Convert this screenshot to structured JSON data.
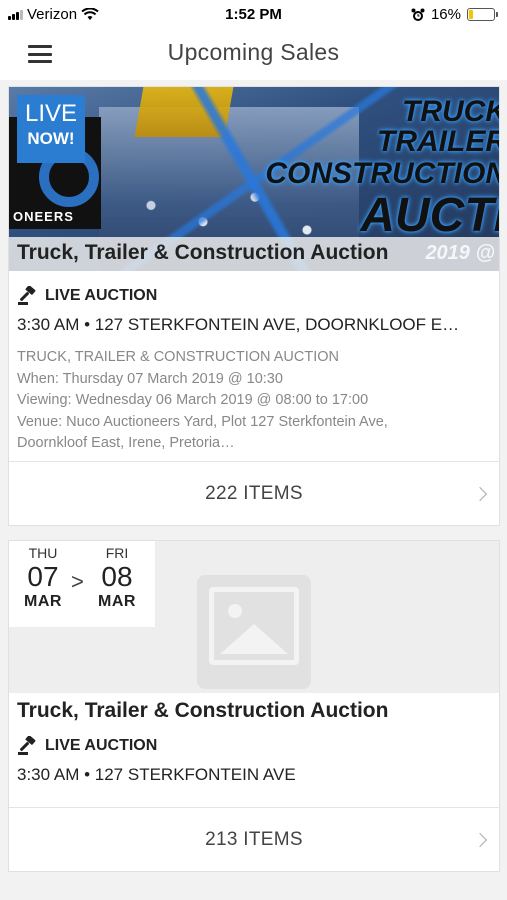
{
  "status_bar": {
    "carrier": "Verizon",
    "time": "1:52 PM",
    "battery_percent": "16%",
    "battery_level": 0.16
  },
  "header": {
    "title": "Upcoming Sales",
    "menu_icon": "hamburger-menu-icon"
  },
  "sales": [
    {
      "banner": {
        "live_badge_line1": "LIVE",
        "live_badge_line2": "NOW!",
        "logo_text": "ONEERS",
        "words": [
          "TRUCK",
          "TRAILER",
          "CONSTRUCTION",
          "AUCTI"
        ],
        "overlay_title": "Truck, Trailer & Construction Auction",
        "overlay_year": "2019 @"
      },
      "type": "LIVE AUCTION",
      "time_location": "3:30 AM • 127 STERKFONTEIN AVE, DOORNKLOOF E…",
      "description": [
        "TRUCK, TRAILER & CONSTRUCTION AUCTION",
        "When: Thursday 07 March 2019 @ 10:30",
        "Viewing: Wednesday 06 March 2019 @ 08:00 to 17:00",
        "Venue: Nuco Auctioneers Yard, Plot 127 Sterkfontein Ave,",
        "Doornkloof East, Irene, Pretoria…"
      ],
      "items_label": "222 ITEMS"
    },
    {
      "dates": {
        "start_dow": "THU",
        "start_day": "07",
        "start_month": "MAR",
        "arrow": ">",
        "end_dow": "FRI",
        "end_day": "08",
        "end_month": "MAR"
      },
      "title": "Truck, Trailer & Construction Auction",
      "type": "LIVE AUCTION",
      "time_location": "3:30 AM • 127 STERKFONTEIN AVE",
      "items_label": "213 ITEMS"
    }
  ],
  "colors": {
    "accent_blue": "#2b7dd2",
    "battery_fill": "#f5c400"
  }
}
